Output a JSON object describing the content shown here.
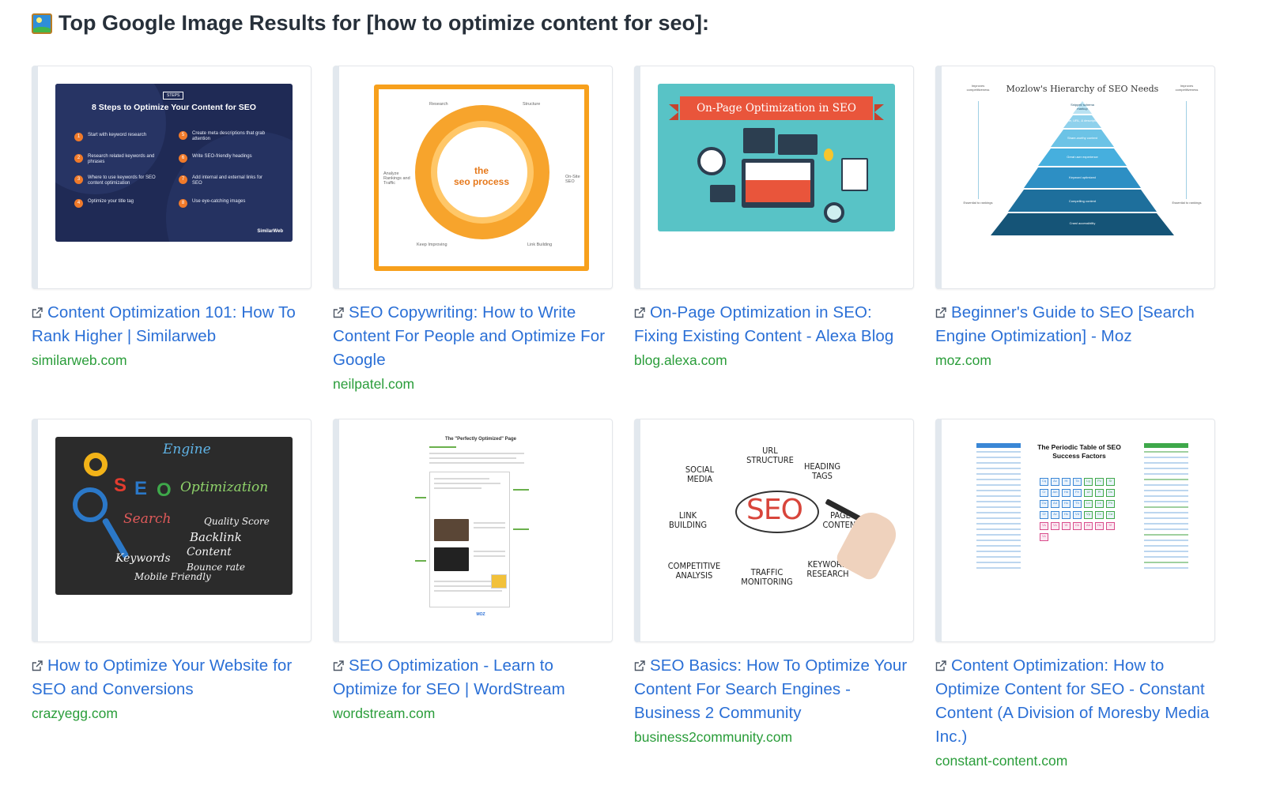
{
  "heading": "Top Google Image Results for [how to optimize content for seo]:",
  "results": [
    {
      "title": "Content Optimization 101: How To Rank Higher | Similarweb",
      "domain": "similarweb.com",
      "thumb": {
        "badge": "STEPS",
        "title": "8 Steps to Optimize Your Content for SEO",
        "steps": [
          "Start with keyword research",
          "Research related keywords and phrases",
          "Where to use keywords for SEO content optimization",
          "Optimize your title tag",
          "Create meta descriptions that grab attention",
          "Write SEO-friendly headings",
          "Add internal and external links for SEO",
          "Use eye-catching images"
        ],
        "brand": "SimilarWeb"
      }
    },
    {
      "title": "SEO Copywriting: How to Write Content For People and Optimize For Google",
      "domain": "neilpatel.com",
      "thumb": {
        "center_line1": "the",
        "center_line2": "seo process",
        "labels": [
          "Research",
          "Structure",
          "On-Site SEO",
          "Link Building",
          "Keep Improving",
          "Analyze Rankings and Traffic"
        ]
      }
    },
    {
      "title": "On-Page Optimization in SEO: Fixing Existing Content - Alexa Blog",
      "domain": "blog.alexa.com",
      "thumb": {
        "ribbon": "On-Page Optimization in SEO"
      }
    },
    {
      "title": "Beginner's Guide to SEO [Search Engine Optimization] - Moz",
      "domain": "moz.com",
      "thumb": {
        "title": "Mozlow's Hierarchy of SEO Needs",
        "side_top": "Improves competitiveness",
        "side_bottom": "Essential to rankings",
        "layers": [
          "Snippet/ schema markup",
          "Title, URL, & description",
          "Share-worthy content",
          "Great user experience",
          "Keyword optimized",
          "Compelling content",
          "Crawl accessibility"
        ]
      }
    },
    {
      "title": "How to Optimize Your Website for SEO and Conversions",
      "domain": "crazyegg.com",
      "thumb": {
        "words": [
          "Engine",
          "Optimization",
          "Search",
          "Quality Score",
          "Backlink",
          "Content",
          "Keywords",
          "Bounce rate",
          "Mobile Friendly"
        ]
      }
    },
    {
      "title": "SEO Optimization - Learn to Optimize for SEO | WordStream",
      "domain": "wordstream.com",
      "thumb": {
        "title": "The \"Perfectly Optimized\" Page",
        "brand": "MOZ"
      }
    },
    {
      "title": "SEO Basics: How To Optimize Your Content For Search Engines - Business 2 Community",
      "domain": "business2community.com",
      "thumb": {
        "center": "SEO",
        "words": [
          "SOCIAL MEDIA",
          "URL STRUCTURE",
          "HEADING TAGS",
          "LINK BUILDING",
          "PAGE CONTENT",
          "COMPETITIVE ANALYSIS",
          "TRAFFIC MONITORING",
          "KEYWORD RESEARCH"
        ]
      }
    },
    {
      "title": "Content Optimization: How to Optimize Content for SEO - Constant Content (A Division of Moresby Media Inc.)",
      "domain": "constant-content.com",
      "thumb": {
        "title": "The Periodic Table of SEO Success Factors",
        "cells": [
          "Cq",
          "Ac",
          "Ht",
          "Ta",
          "Lg",
          "Pc",
          "Sr",
          "Cr",
          "Am",
          "Hd",
          "Fe",
          "Ul",
          "Pl",
          "Ds",
          "Cw",
          "Ad",
          "Ho",
          "Th",
          "Ln",
          "Ls",
          "Ph",
          "Cf",
          "Av",
          "Hs",
          "Vd",
          "Vp",
          "Cv",
          "Ca",
          "Vs",
          "Vc",
          "Vt",
          "Ck",
          "Ab",
          "Hc",
          "Vl",
          "Vc"
        ]
      }
    }
  ],
  "colors": {
    "link": "#2a6fd6",
    "domain": "#2a9d3a"
  }
}
